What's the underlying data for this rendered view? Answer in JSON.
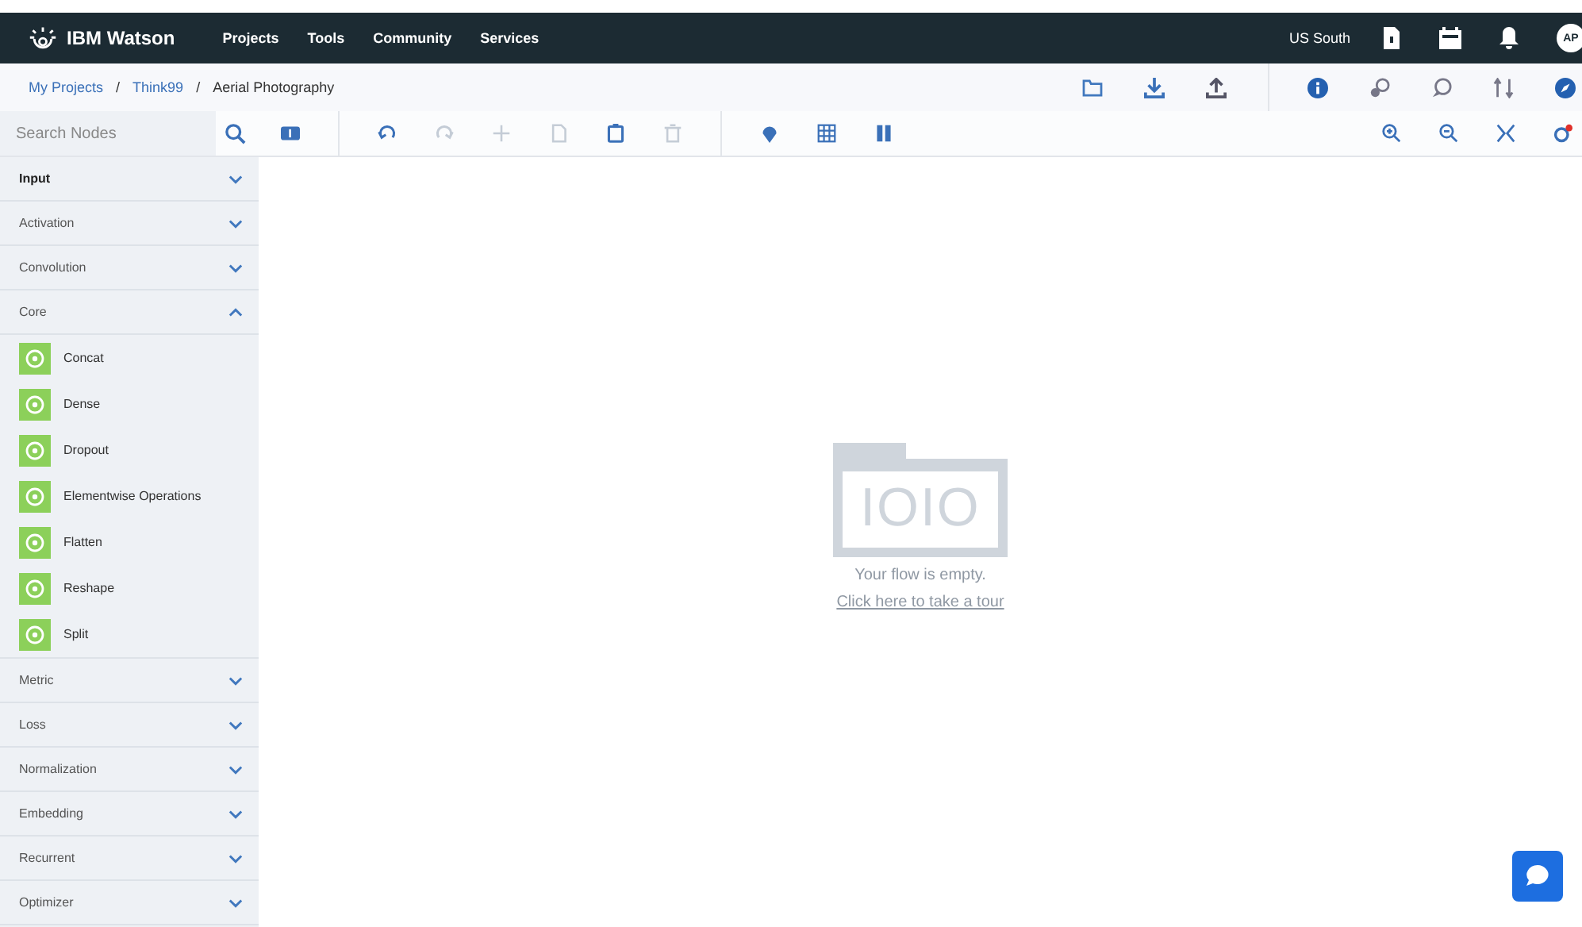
{
  "navbar": {
    "brand": "IBM Watson",
    "menu": [
      "Projects",
      "Tools",
      "Community",
      "Services"
    ],
    "region": "US South",
    "avatar": "AP"
  },
  "breadcrumb": {
    "links": [
      "My Projects",
      "Think99"
    ],
    "separator": "/",
    "current": "Aerial Photography"
  },
  "toolbar": {
    "search": {
      "placeholder": "Search Nodes"
    },
    "tools": [
      {
        "kind": "sidebar",
        "disabled": false
      },
      {
        "kind": "undo",
        "disabled": false
      },
      {
        "kind": "redo",
        "disabled": true
      },
      {
        "kind": "plus",
        "disabled": true
      },
      {
        "kind": "copy",
        "disabled": true
      },
      {
        "kind": "paste",
        "disabled": false
      },
      {
        "kind": "trash",
        "disabled": true
      },
      {
        "kind": "pin",
        "disabled": false
      },
      {
        "kind": "grid",
        "disabled": false
      },
      {
        "kind": "columns",
        "disabled": false
      }
    ]
  },
  "sidebar": {
    "categories": [
      {
        "label": "Input",
        "expanded": false,
        "active": true
      },
      {
        "label": "Activation",
        "expanded": false,
        "active": false
      },
      {
        "label": "Convolution",
        "expanded": false,
        "active": false
      },
      {
        "label": "Core",
        "expanded": true,
        "active": false,
        "children": [
          {
            "label": "Concat"
          },
          {
            "label": "Dense"
          },
          {
            "label": "Dropout"
          },
          {
            "label": "Elementwise Operations"
          },
          {
            "label": "Flatten"
          },
          {
            "label": "Reshape"
          },
          {
            "label": "Split"
          }
        ]
      },
      {
        "label": "Metric",
        "expanded": false,
        "active": false
      },
      {
        "label": "Loss",
        "expanded": false,
        "active": false
      },
      {
        "label": "Normalization",
        "expanded": false,
        "active": false
      },
      {
        "label": "Embedding",
        "expanded": false,
        "active": false
      },
      {
        "label": "Recurrent",
        "expanded": false,
        "active": false
      },
      {
        "label": "Optimizer",
        "expanded": false,
        "active": false
      }
    ]
  },
  "canvas": {
    "empty_state": {
      "icon_text": "IOIO",
      "message": "Your flow is empty.",
      "link": "Click here to take a tour"
    }
  }
}
